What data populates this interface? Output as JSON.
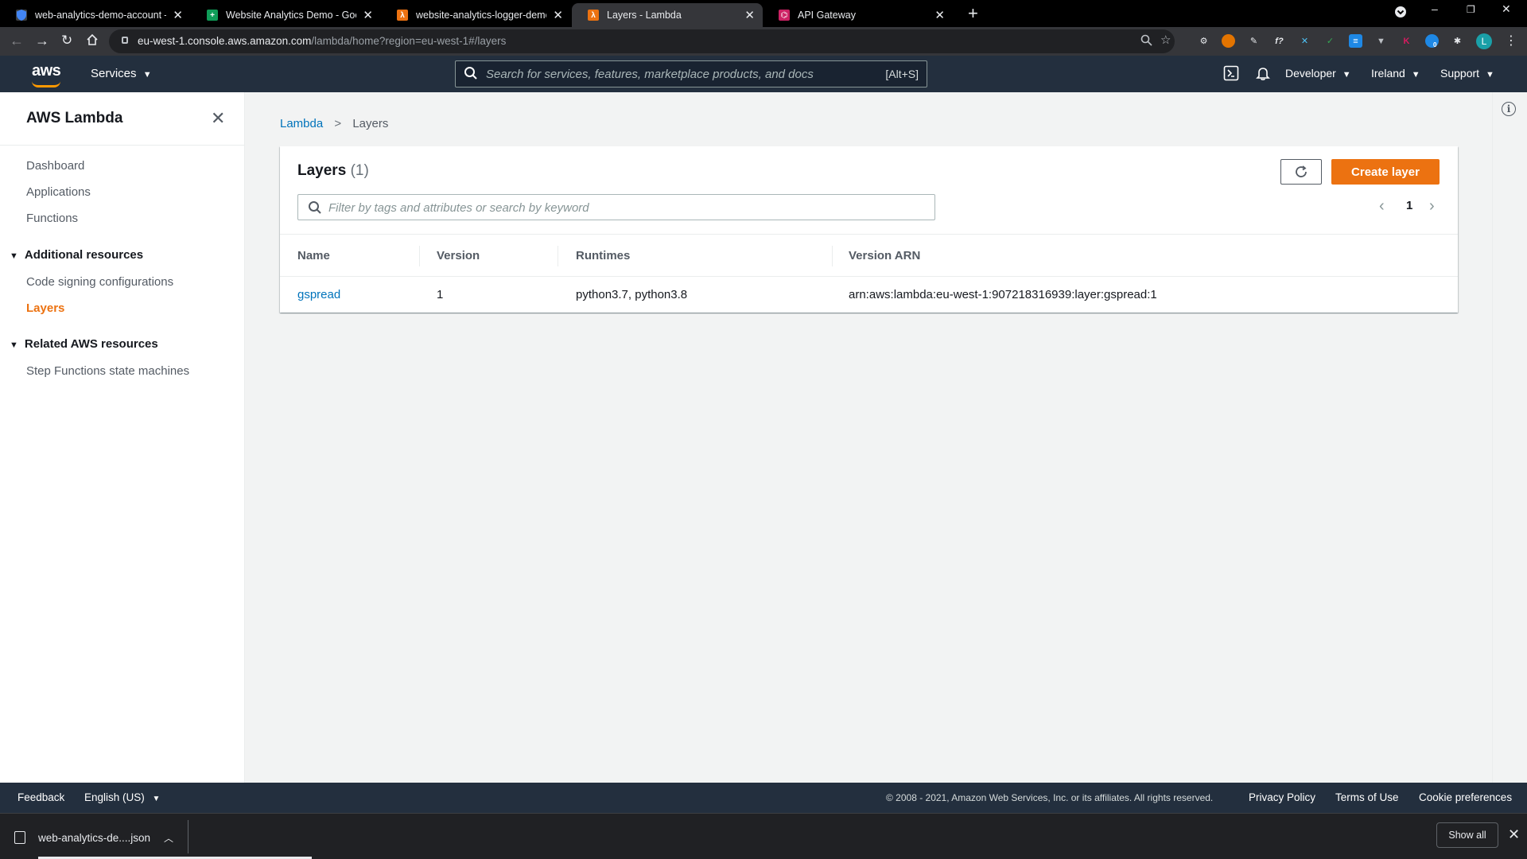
{
  "browser": {
    "tabs": [
      {
        "title": "web-analytics-demo-account – I",
        "favicon": "shield-icon",
        "color": "#4285f4"
      },
      {
        "title": "Website Analytics Demo - Googl",
        "favicon": "sheets-icon",
        "color": "#0f9d58"
      },
      {
        "title": "website-analytics-logger-demo -",
        "favicon": "lambda-icon",
        "color": "#ec7211"
      },
      {
        "title": "Layers - Lambda",
        "favicon": "lambda-icon",
        "color": "#ec7211",
        "active": true
      },
      {
        "title": "API Gateway",
        "favicon": "api-gateway-icon",
        "color": "#cc2264"
      }
    ],
    "url_host": "eu-west-1.console.aws.amazon.com",
    "url_path": "/lambda/home?region=eu-west-1#/layers",
    "profile_initial": "L",
    "ext_badge": "0"
  },
  "aws_nav": {
    "logo": "aws",
    "services_label": "Services",
    "search_placeholder": "Search for services, features, marketplace products, and docs",
    "search_shortcut": "[Alt+S]",
    "account_label": "Developer",
    "region_label": "Ireland",
    "support_label": "Support"
  },
  "sidebar": {
    "title": "AWS Lambda",
    "items": [
      {
        "label": "Dashboard"
      },
      {
        "label": "Applications"
      },
      {
        "label": "Functions"
      }
    ],
    "section_additional": "Additional resources",
    "additional_items": [
      {
        "label": "Code signing configurations"
      },
      {
        "label": "Layers",
        "active": true
      }
    ],
    "section_related": "Related AWS resources",
    "related_items": [
      {
        "label": "Step Functions state machines"
      }
    ]
  },
  "breadcrumb": {
    "root": "Lambda",
    "current": "Layers"
  },
  "layers_panel": {
    "title": "Layers",
    "count": "(1)",
    "create_label": "Create layer",
    "filter_placeholder": "Filter by tags and attributes or search by keyword",
    "page_number": "1",
    "columns": [
      "Name",
      "Version",
      "Runtimes",
      "Version ARN"
    ],
    "rows": [
      {
        "name": "gspread",
        "version": "1",
        "runtimes": "python3.7, python3.8",
        "arn": "arn:aws:lambda:eu-west-1:907218316939:layer:gspread:1"
      }
    ]
  },
  "footer": {
    "feedback": "Feedback",
    "language": "English (US)",
    "copyright": "© 2008 - 2021, Amazon Web Services, Inc. or its affiliates. All rights reserved.",
    "privacy": "Privacy Policy",
    "terms": "Terms of Use",
    "cookies": "Cookie preferences"
  },
  "downloads": {
    "file": "web-analytics-de....json",
    "show_all": "Show all"
  },
  "colors": {
    "aws_squid_ink": "#232f3e",
    "aws_orange": "#ec7211",
    "link_blue": "#0073bb"
  }
}
